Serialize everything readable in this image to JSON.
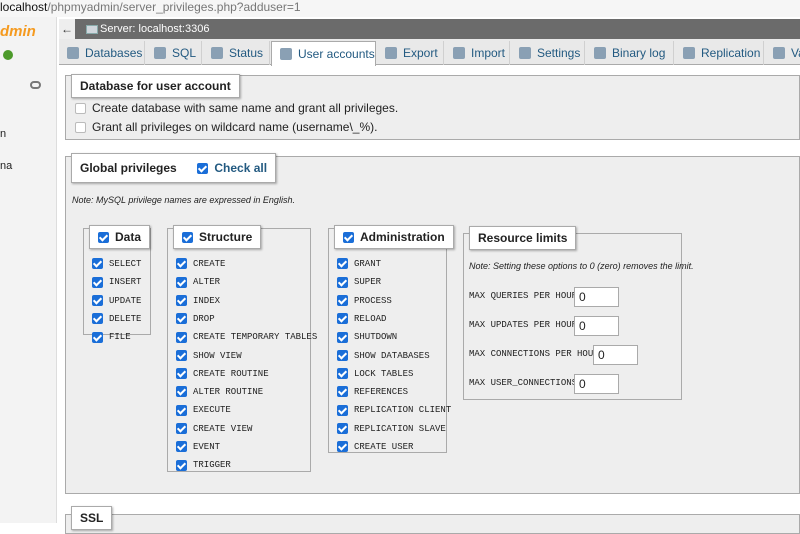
{
  "address_bar": {
    "host": "localhost",
    "path": "/phpmyadmin/server_privileges.php?adduser=1"
  },
  "sidebar": {
    "logo_text": "dmin",
    "item_1": "n",
    "item_2": "na"
  },
  "server_bar": {
    "back": "←",
    "label": "Server: localhost:3306"
  },
  "tabs": [
    {
      "label": "Databases",
      "icon": "database-icon"
    },
    {
      "label": "SQL",
      "icon": "sql-icon"
    },
    {
      "label": "Status",
      "icon": "status-icon"
    },
    {
      "label": "User accounts",
      "icon": "users-icon"
    },
    {
      "label": "Export",
      "icon": "export-icon"
    },
    {
      "label": "Import",
      "icon": "import-icon"
    },
    {
      "label": "Settings",
      "icon": "wrench-icon"
    },
    {
      "label": "Binary log",
      "icon": "binlog-icon"
    },
    {
      "label": "Replication",
      "icon": "replication-icon"
    },
    {
      "label": "Va",
      "icon": "variables-icon"
    }
  ],
  "db_for_user": {
    "legend": "Database for user account",
    "options": [
      "Create database with same name and grant all privileges.",
      "Grant all privileges on wildcard name (username\\_%)."
    ]
  },
  "global_privileges": {
    "legend": "Global privileges",
    "check_all": "Check all",
    "note": "Note: MySQL privilege names are expressed in English."
  },
  "data_group": {
    "legend": "Data",
    "items": [
      "SELECT",
      "INSERT",
      "UPDATE",
      "DELETE",
      "FILE"
    ]
  },
  "structure_group": {
    "legend": "Structure",
    "items": [
      "CREATE",
      "ALTER",
      "INDEX",
      "DROP",
      "CREATE TEMPORARY TABLES",
      "SHOW VIEW",
      "CREATE ROUTINE",
      "ALTER ROUTINE",
      "EXECUTE",
      "CREATE VIEW",
      "EVENT",
      "TRIGGER"
    ]
  },
  "admin_group": {
    "legend": "Administration",
    "items": [
      "GRANT",
      "SUPER",
      "PROCESS",
      "RELOAD",
      "SHUTDOWN",
      "SHOW DATABASES",
      "LOCK TABLES",
      "REFERENCES",
      "REPLICATION CLIENT",
      "REPLICATION SLAVE",
      "CREATE USER"
    ]
  },
  "resource_limits": {
    "legend": "Resource limits",
    "note": "Note: Setting these options to 0 (zero) removes the limit.",
    "rows": [
      {
        "label": "MAX QUERIES PER HOUR",
        "value": "0"
      },
      {
        "label": "MAX UPDATES PER HOUR",
        "value": "0"
      },
      {
        "label": "MAX CONNECTIONS PER HOUR",
        "value": "0"
      },
      {
        "label": "MAX USER_CONNECTIONS",
        "value": "0"
      }
    ]
  },
  "ssl": {
    "legend": "SSL"
  },
  "colors": {
    "link": "#235a81",
    "checkbox": "#1a6ed8",
    "panel_bg": "#eeeeee"
  }
}
